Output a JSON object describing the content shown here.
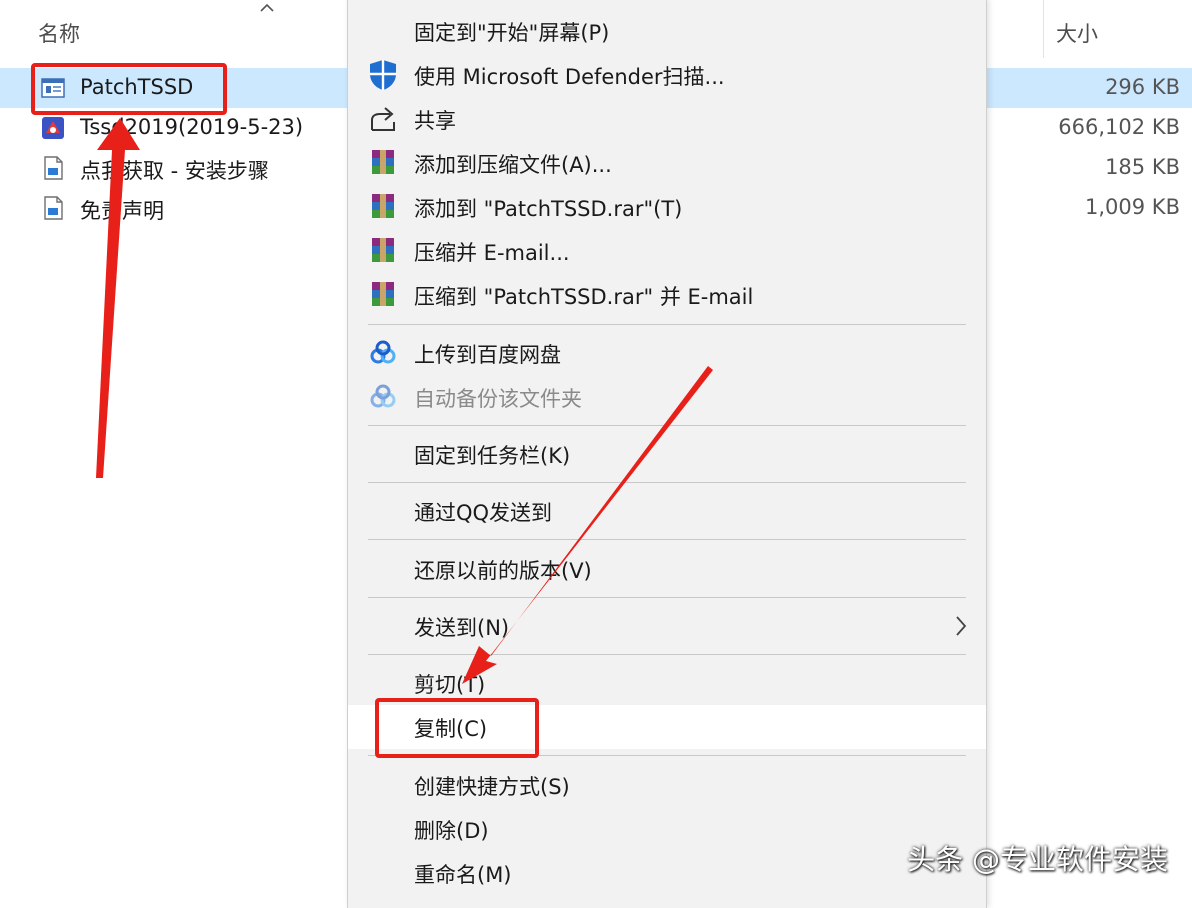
{
  "explorer": {
    "columns": {
      "name": "名称",
      "size": "大小"
    },
    "files": [
      {
        "name": "PatchTSSD",
        "size": "296 KB",
        "icon": "application-icon",
        "selected": true
      },
      {
        "name": "Tssd2019(2019-5-23)",
        "size": "666,102 KB",
        "icon": "installer-icon",
        "selected": false
      },
      {
        "name": "点我获取 - 安装步骤",
        "size": "185 KB",
        "icon": "document-icon",
        "selected": false
      },
      {
        "name": "免责声明",
        "size": "1,009 KB",
        "icon": "document-icon",
        "selected": false
      }
    ]
  },
  "menu": {
    "items": [
      {
        "label": "固定到\"开始\"屏幕(P)",
        "icon": ""
      },
      {
        "label": "使用 Microsoft Defender扫描...",
        "icon": "defender-shield-icon"
      },
      {
        "label": "共享",
        "icon": "share-icon"
      },
      {
        "label": "添加到压缩文件(A)...",
        "icon": "winrar-icon"
      },
      {
        "label": "添加到 \"PatchTSSD.rar\"(T)",
        "icon": "winrar-icon"
      },
      {
        "label": "压缩并 E-mail...",
        "icon": "winrar-icon"
      },
      {
        "label": "压缩到 \"PatchTSSD.rar\" 并 E-mail",
        "icon": "winrar-icon"
      },
      {
        "label": "上传到百度网盘",
        "icon": "baidu-netdisk-icon"
      },
      {
        "label": "自动备份该文件夹",
        "icon": "baidu-netdisk-icon",
        "disabled": true
      },
      {
        "label": "固定到任务栏(K)",
        "icon": ""
      },
      {
        "label": "通过QQ发送到",
        "icon": ""
      },
      {
        "label": "还原以前的版本(V)",
        "icon": ""
      },
      {
        "label": "发送到(N)",
        "icon": "",
        "submenu": true
      },
      {
        "label": "剪切(T)",
        "icon": ""
      },
      {
        "label": "复制(C)",
        "icon": "",
        "highlighted": true
      },
      {
        "label": "创建快捷方式(S)",
        "icon": ""
      },
      {
        "label": "删除(D)",
        "icon": ""
      },
      {
        "label": "重命名(M)",
        "icon": ""
      }
    ]
  },
  "annotation_color": "#e8201a",
  "watermark": "头条 @专业软件安装"
}
